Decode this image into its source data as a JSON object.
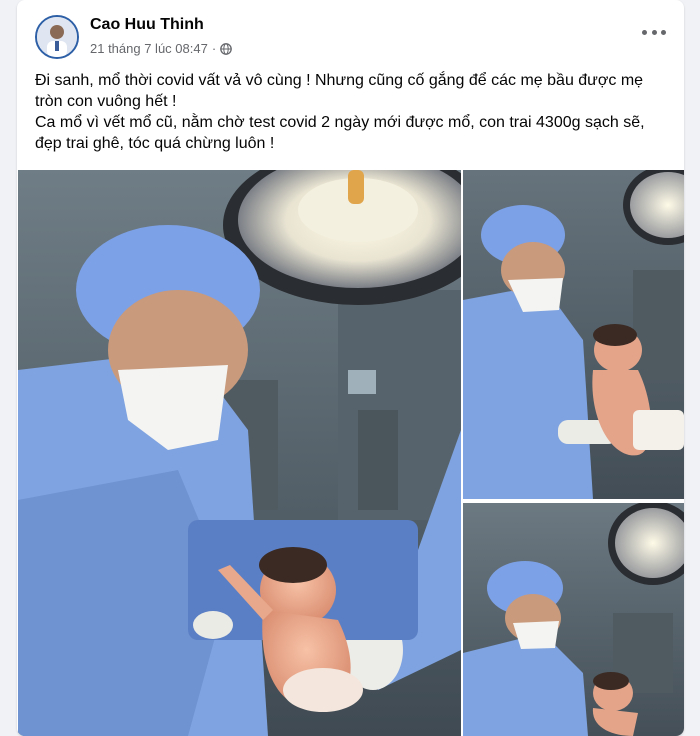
{
  "post": {
    "author": "Cao Huu Thinh",
    "timestamp": "21 tháng 7 lúc 08:47",
    "separator": "·",
    "privacy_icon": "globe-icon",
    "more_icon": "more-horizontal-icon",
    "text_line_1": "Đi sanh, mổ thời covid vất vả vô cùng ! Nhưng cũng cố gắng để các mẹ bầu được mẹ tròn con vuông hết !",
    "text_line_2": "Ca mổ vì vết mổ cũ, nằm chờ test covid 2 ngày mới được mổ, con trai 4300g sạch sẽ, đẹp trai ghê, tóc quá chừng luôn !"
  },
  "photos": [
    {
      "name": "main-photo",
      "description_icon": "photo"
    },
    {
      "name": "side-photo-1",
      "description_icon": "photo"
    },
    {
      "name": "side-photo-2",
      "description_icon": "photo"
    }
  ],
  "colors": {
    "accent": "#2d5fa6",
    "text": "#050505",
    "secondary_text": "#65676b",
    "scrub_blue": "#7fa3e0"
  }
}
